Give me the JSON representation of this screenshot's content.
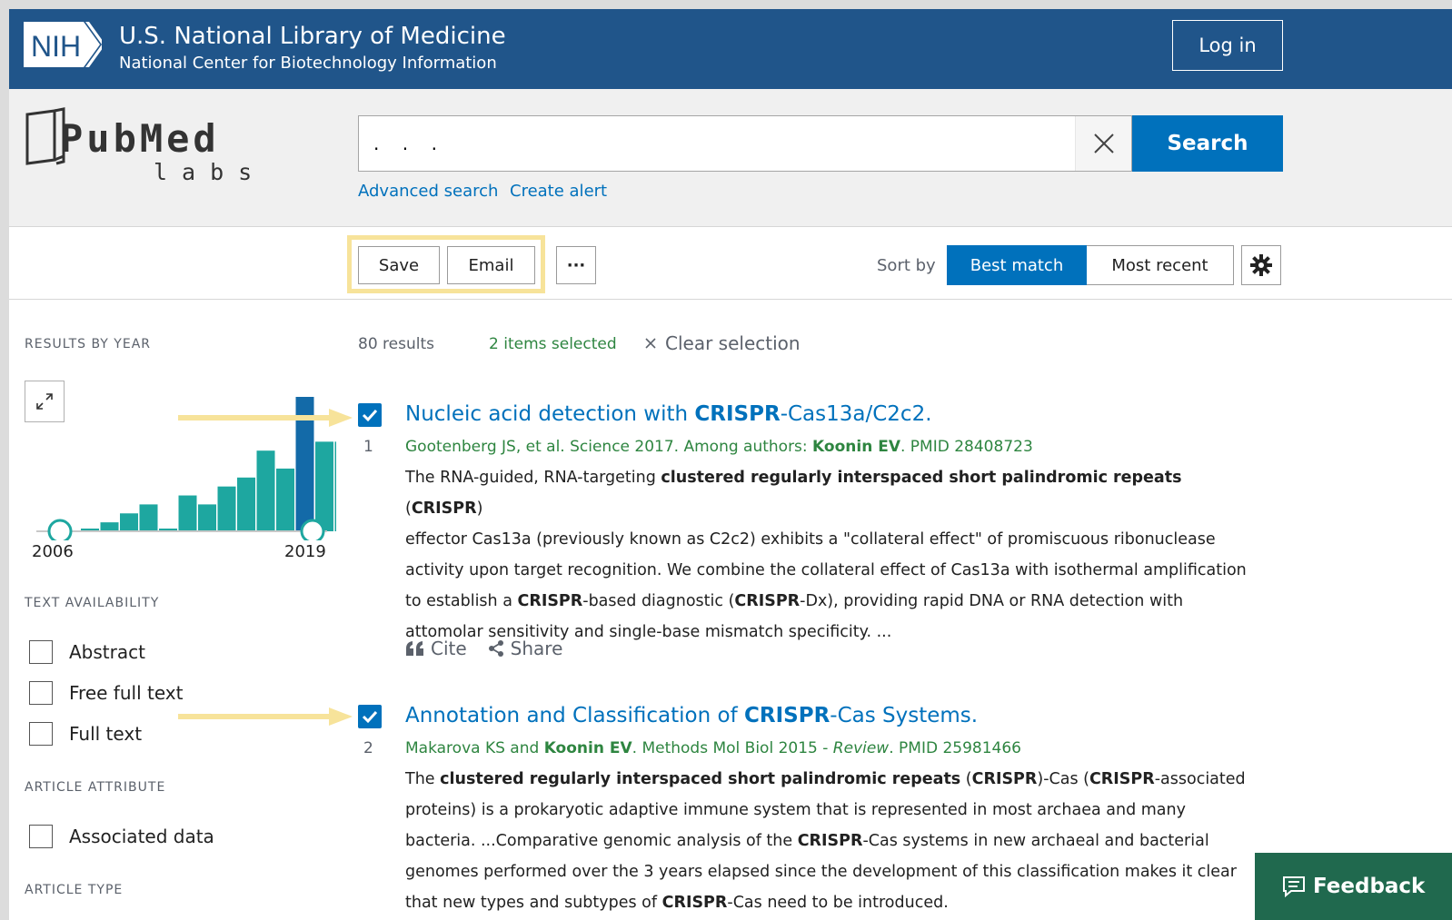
{
  "header": {
    "org_name": "U.S. National Library of Medicine",
    "org_sub": "National Center for Biotechnology Information",
    "login_label": "Log in",
    "nih_logo_text": "NIH"
  },
  "search": {
    "logo_main": "PubMed",
    "logo_sub": "labs",
    "query": ".    .    .",
    "search_label": "Search",
    "advanced_label": "Advanced search",
    "alert_label": "Create alert"
  },
  "toolbar": {
    "save_label": "Save",
    "email_label": "Email",
    "more_label": "···",
    "sort_label": "Sort by",
    "sort_options": [
      "Best match",
      "Most recent"
    ],
    "sort_selected": "Best match"
  },
  "sidebar": {
    "results_by_year_heading": "RESULTS BY YEAR",
    "year_start": "2006",
    "year_end": "2019",
    "text_availability_heading": "TEXT AVAILABILITY",
    "text_filters": [
      "Abstract",
      "Free full text",
      "Full text"
    ],
    "article_attribute_heading": "ARTICLE ATTRIBUTE",
    "attribute_filters": [
      "Associated data"
    ],
    "article_type_heading": "ARTICLE TYPE"
  },
  "chart_data": {
    "type": "bar",
    "categories": [
      "2006",
      "2007",
      "2008",
      "2009",
      "2010",
      "2011",
      "2012",
      "2013",
      "2014",
      "2015",
      "2016",
      "2017",
      "2018",
      "2019"
    ],
    "values": [
      0,
      1,
      2,
      3,
      0,
      4,
      3,
      5,
      6,
      9,
      7,
      15,
      10,
      10
    ],
    "highlighted_category": "2017",
    "colors": {
      "bar": "#1ea7a0",
      "highlight": "#136aa8"
    }
  },
  "results": {
    "count_text": "80 results",
    "selected_text": "2 items selected",
    "clear_selection_label": "Clear selection",
    "items": [
      {
        "number": "1",
        "title_pre": "Nucleic acid detection with ",
        "title_hl": "CRISPR",
        "title_post": "-Cas13a/C2c2.",
        "meta_pre": "Gootenberg JS, et al. Science 2017. Among authors: ",
        "meta_author": "Koonin EV",
        "meta_post": ". PMID 28408723",
        "snippet_lines": [
          [
            "The RNA-guided, RNA-targeting ",
            "clustered regularly interspaced short palindromic repeats",
            " (",
            "CRISPR",
            ")"
          ],
          [
            "effector Cas13a (previously known as C2c2) exhibits a \"collateral effect\" of promiscuous ribonuclease"
          ],
          [
            "activity upon target recognition. We combine the collateral effect of Cas13a with isothermal amplification"
          ],
          [
            "to establish a ",
            "CRISPR",
            "-based diagnostic (",
            "CRISPR",
            "-Dx), providing rapid DNA or RNA detection with"
          ],
          [
            "attomolar sensitivity and single-base mismatch specificity. ..."
          ]
        ],
        "cite_label": "Cite",
        "share_label": "Share"
      },
      {
        "number": "2",
        "title_pre": "Annotation and Classification of ",
        "title_hl": "CRISPR",
        "title_post": "-Cas Systems.",
        "meta_pre": "Makarova KS and ",
        "meta_author": "Koonin EV",
        "meta_mid": ". Methods Mol Biol 2015 - ",
        "meta_review": "Review",
        "meta_post": ". PMID 25981466",
        "snippet_lines": [
          [
            "The ",
            "clustered regularly interspaced short palindromic repeats",
            " (",
            "CRISPR",
            ")-Cas (",
            "CRISPR",
            "-associated"
          ],
          [
            "proteins) is a prokaryotic adaptive immune system that is represented in most archaea and many"
          ],
          [
            "bacteria. ...Comparative genomic analysis of the ",
            "CRISPR",
            "-Cas systems in new archaeal and bacterial"
          ],
          [
            "genomes performed over the 3 years elapsed since the development of this classification makes it clear"
          ],
          [
            "that new types and subtypes of ",
            "CRISPR",
            "-Cas need to be introduced."
          ]
        ]
      }
    ]
  },
  "feedback_label": "Feedback"
}
